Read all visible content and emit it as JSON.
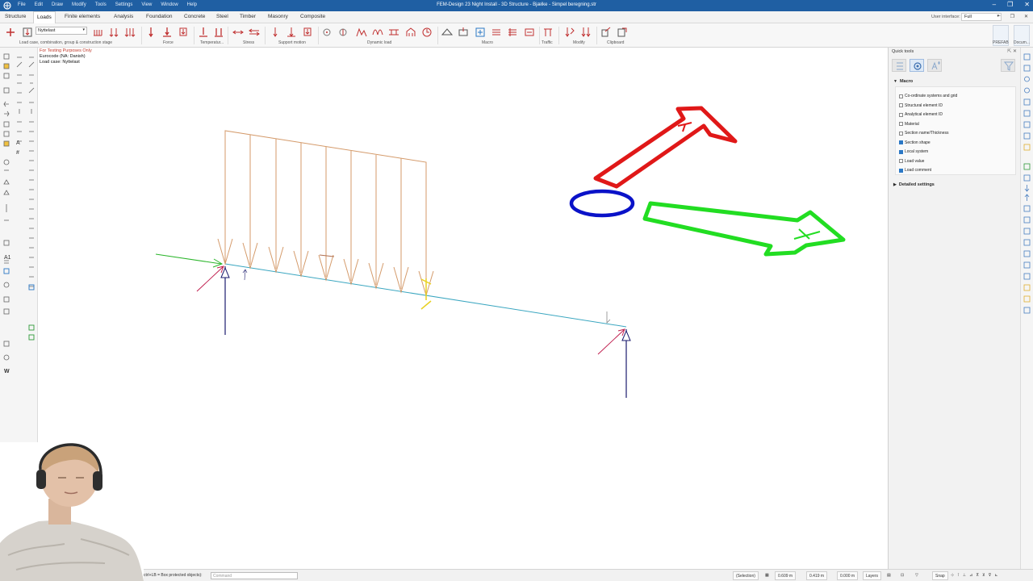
{
  "titlebar": {
    "menu": [
      "File",
      "Edit",
      "Draw",
      "Modify",
      "Tools",
      "Settings",
      "View",
      "Window",
      "Help"
    ],
    "title": "FEM-Design 23 Night Install - 3D Structure - Bjælke - Simpel beregning.str"
  },
  "tabs": {
    "items": [
      "Structure",
      "Loads",
      "Finite elements",
      "Analysis",
      "Foundation",
      "Concrete",
      "Steel",
      "Timber",
      "Masonry",
      "Composite"
    ],
    "active": "Loads",
    "ui_label": "User interface:",
    "ui_value": "Full"
  },
  "ribbon": {
    "load_case_dropdown": "Nyttelast",
    "groups": [
      "Load case, combination, group & construction stage",
      "Force",
      "Temperatur...",
      "Stress",
      "Support motion",
      "Dynamic load",
      "Macro",
      "Traffic",
      "Modify",
      "Clipboard"
    ],
    "right_buttons": [
      "PREFAB",
      "Docum..."
    ]
  },
  "canvas_info": {
    "testing": "For Testing Purposes Only",
    "eurocode": "Eurocode (NA: Danish)",
    "load_case": "Load case: Nyttelast"
  },
  "quick_tools": {
    "title": "Quick tools",
    "macro_section": "Macro",
    "detailed_section": "Detailed settings",
    "checkboxes": [
      {
        "label": "Co-ordinate systems and grid",
        "checked": false
      },
      {
        "label": "Structural element ID",
        "checked": false
      },
      {
        "label": "Analytical element ID",
        "checked": false
      },
      {
        "label": "Material",
        "checked": false
      },
      {
        "label": "Section name/Thickness",
        "checked": false
      },
      {
        "label": "Section shape",
        "checked": true
      },
      {
        "label": "Local system",
        "checked": true
      },
      {
        "label": "Load value",
        "checked": false
      },
      {
        "label": "Load comment",
        "checked": true
      }
    ]
  },
  "statusbar": {
    "command_hint": "ctrl+LB = Box protected objects):",
    "command_placeholder": "Command",
    "selection": "(Selection)",
    "x": "0.609 m",
    "y": "0.419 m",
    "z": "0.000 m",
    "layers": "Layers",
    "snap": "Snap"
  },
  "colors": {
    "accent": "#1f5fa3",
    "load_arrows": "#d49a6a",
    "beam": "#3aa6c0",
    "support": "#1a1a6e",
    "support_arrow": "#c02050",
    "gizmo_red": "#e01818",
    "gizmo_green": "#22dd22",
    "gizmo_blue": "#0a12c8"
  }
}
